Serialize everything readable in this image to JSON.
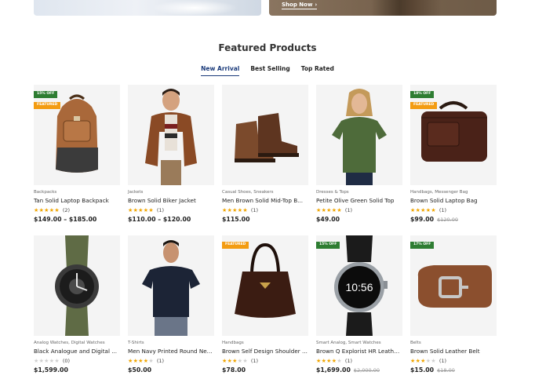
{
  "banner": {
    "shop_now_label": "Shop Now",
    "chevron_glyph": "›"
  },
  "section": {
    "title": "Featured Products",
    "tabs": [
      {
        "label": "New Arrival",
        "active": true
      },
      {
        "label": "Best Selling",
        "active": false
      },
      {
        "label": "Top Rated",
        "active": false
      }
    ]
  },
  "products": [
    {
      "category": "Backpacks",
      "name": "Tan Solid Laptop Backpack",
      "rating": 5,
      "reviews": "(2)",
      "price": "$149.00 – $185.00",
      "old_price": "",
      "badges": [
        "15% OFF",
        "FEATURED"
      ],
      "icon": "backpack-image"
    },
    {
      "category": "Jackets",
      "name": "Brown Solid Biker Jacket",
      "rating": 5,
      "reviews": "(1)",
      "price": "$110.00 – $120.00",
      "old_price": "",
      "badges": [],
      "icon": "jacket-model-image"
    },
    {
      "category": "Casual Shoes, Sneakers",
      "name": "Men Brown Solid Mid-Top B...",
      "rating": 5,
      "reviews": "(1)",
      "price": "$115.00",
      "old_price": "",
      "badges": [],
      "icon": "boots-image"
    },
    {
      "category": "Dresses & Tops",
      "name": "Petite Olive Green Solid Top",
      "rating": 5,
      "reviews": "(1)",
      "price": "$49.00",
      "old_price": "",
      "badges": [],
      "icon": "top-model-image"
    },
    {
      "category": "Handbags, Messenger Bag",
      "name": "Brown Solid Laptop Bag",
      "rating": 5,
      "reviews": "(1)",
      "price": "$99.00",
      "old_price": "$120.00",
      "badges": [
        "18% OFF",
        "FEATURED"
      ],
      "icon": "laptop-bag-image"
    },
    {
      "category": "Analog Watches, Digital Watches",
      "name": "Black Analogue and Digital ...",
      "rating": 0,
      "reviews": "(0)",
      "price": "$1,599.00",
      "old_price": "",
      "badges": [],
      "icon": "watch-image"
    },
    {
      "category": "T-Shirts",
      "name": "Men Navy Printed Round Ne...",
      "rating": 4,
      "reviews": "(1)",
      "price": "$50.00",
      "old_price": "",
      "badges": [],
      "icon": "tshirt-model-image"
    },
    {
      "category": "Handbags",
      "name": "Brown Self Design Shoulder ...",
      "rating": 3,
      "reviews": "(1)",
      "price": "$78.00",
      "old_price": "",
      "badges": [
        "FEATURED"
      ],
      "icon": "handbag-image"
    },
    {
      "category": "Smart Analog, Smart Watches",
      "name": "Brown Q Explorist HR Leather...",
      "rating": 4,
      "reviews": "(1)",
      "price": "$1,699.00",
      "old_price": "$2,000.00",
      "badges": [
        "15% OFF"
      ],
      "icon": "smartwatch-image"
    },
    {
      "category": "Belts",
      "name": "Brown Solid Leather Belt",
      "rating": 3,
      "reviews": "(1)",
      "price": "$15.00",
      "old_price": "$18.00",
      "badges": [
        "17% OFF"
      ],
      "icon": "belt-image"
    }
  ],
  "smartwatch_time": "10:56",
  "colors": {
    "accent": "#1a3a7a",
    "badge_off": "#2e7d32",
    "badge_featured": "#f39c12",
    "star": "#f0a500"
  }
}
